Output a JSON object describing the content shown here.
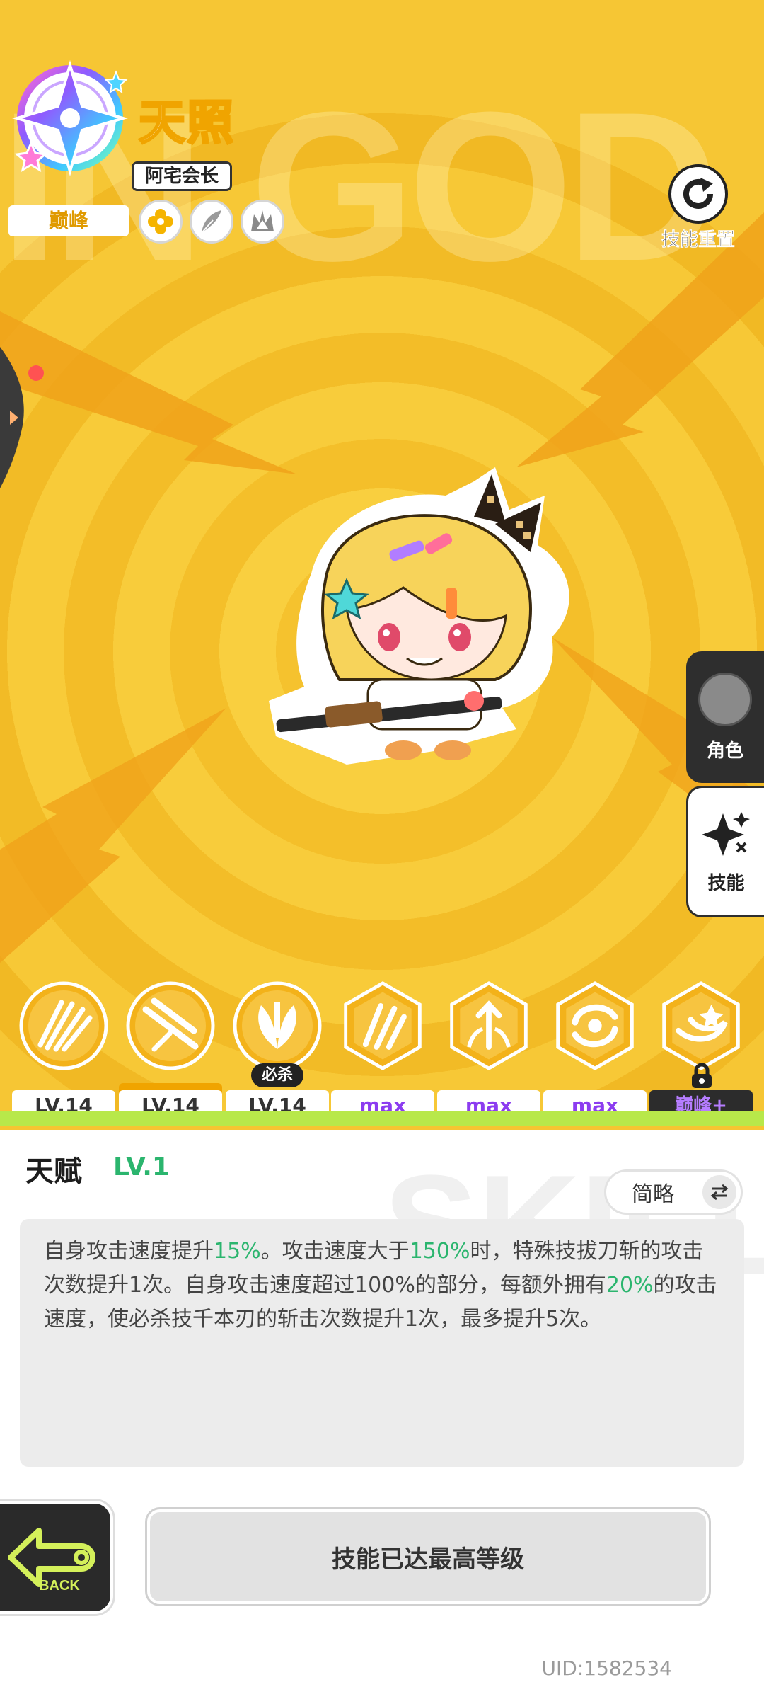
{
  "character": {
    "name": "天照",
    "title": "阿宅会长",
    "rank": "巅峰"
  },
  "attributes": [
    {
      "icon": "gold-flower-icon"
    },
    {
      "icon": "feather-blade-icon"
    },
    {
      "icon": "flame-crown-icon"
    }
  ],
  "reset": {
    "label": "技能重置",
    "icon": "refresh-icon"
  },
  "background_word": "IN GOD",
  "side_tabs": [
    {
      "label": "角色",
      "icon": "avatar-icon",
      "active": false
    },
    {
      "label": "技能",
      "icon": "sparkle-icon",
      "active": true
    }
  ],
  "skills": [
    {
      "level": "LV.14",
      "icon": "fan-strike-icon"
    },
    {
      "level": "LV.14",
      "icon": "crossed-blades-icon",
      "selected": true
    },
    {
      "level": "LV.14",
      "icon": "lotus-slash-icon",
      "badge": "必杀"
    },
    {
      "level": "max",
      "icon": "triple-claw-icon"
    },
    {
      "level": "max",
      "icon": "rising-arrows-icon"
    },
    {
      "level": "max",
      "icon": "whirlwind-icon"
    },
    {
      "level": "巅峰+",
      "icon": "swirl-crest-icon",
      "locked": true
    }
  ],
  "talent": {
    "title": "天赋",
    "level": "LV.1",
    "brief_label": "简略",
    "description": {
      "p1": "自身攻击速度提升",
      "h1": "15%",
      "p2": "。攻击速度大于",
      "h2": "150%",
      "p3": "时，特殊技拔刀斩的攻击次数提升1次。自身攻击速度超过100%的部分，每额外拥有",
      "h3": "20%",
      "p4": "的攻击速度，使必杀技千本刃的斩击次数提升1次，最多提升5次。"
    }
  },
  "panel_background_word": "SKILL",
  "back_label": "BACK",
  "max_button_label": "技能已达最高等级",
  "uid": "UID:1582534",
  "colors": {
    "accent_yellow": "#f6c531",
    "highlight_green": "#2bb56e",
    "max_purple": "#8c3cf0",
    "lime": "#b8e84a"
  }
}
